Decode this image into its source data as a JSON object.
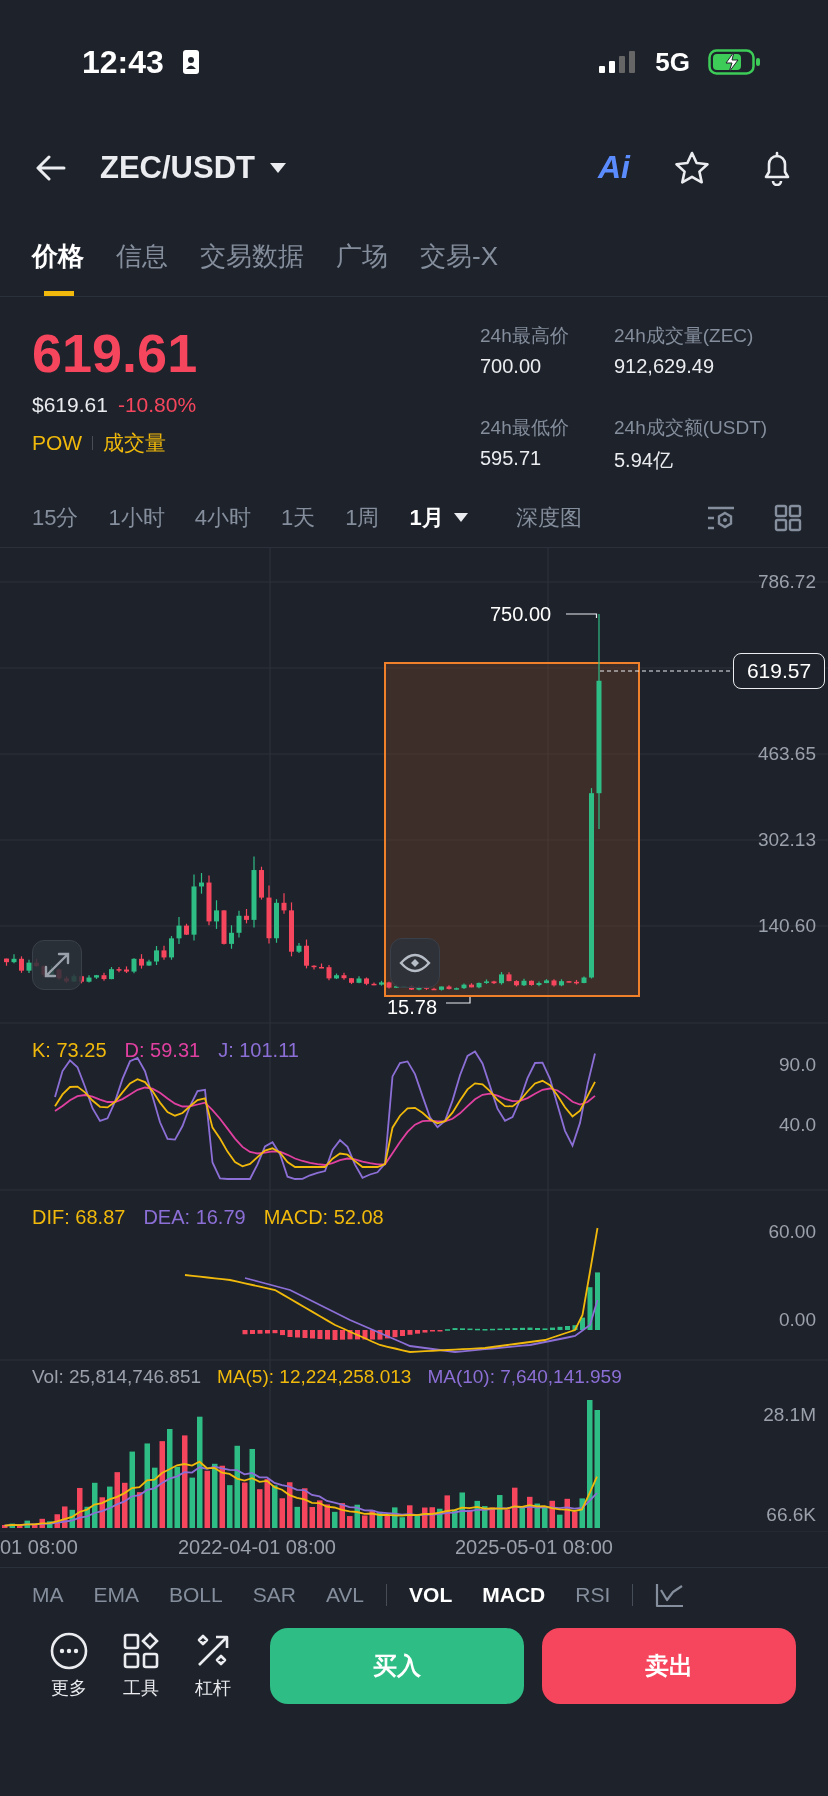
{
  "status_bar": {
    "time": "12:43",
    "network": "5G"
  },
  "header": {
    "pair": "ZEC/USDT",
    "ai_label": "Ai"
  },
  "tabs": [
    {
      "label": "价格",
      "selected": true
    },
    {
      "label": "信息",
      "selected": false
    },
    {
      "label": "交易数据",
      "selected": false
    },
    {
      "label": "广场",
      "selected": false
    },
    {
      "label": "交易-X",
      "selected": false
    }
  ],
  "price": {
    "last": "619.61",
    "usd": "$619.61",
    "change": "-10.80%",
    "tags": [
      "POW",
      "成交量"
    ]
  },
  "stats": [
    {
      "label": "24h最高价",
      "value": "700.00"
    },
    {
      "label": "24h成交量(ZEC)",
      "value": "912,629.49"
    },
    {
      "label": "24h最低价",
      "value": "595.71"
    },
    {
      "label": "24h成交额(USDT)",
      "value": "5.94亿"
    }
  ],
  "intervals": [
    {
      "label": "15分",
      "selected": false
    },
    {
      "label": "1小时",
      "selected": false
    },
    {
      "label": "4小时",
      "selected": false
    },
    {
      "label": "1天",
      "selected": false
    },
    {
      "label": "1周",
      "selected": false
    },
    {
      "label": "1月",
      "selected": true
    },
    {
      "label": "深度图",
      "selected": false
    }
  ],
  "price_chart": {
    "y_labels": [
      "786.72",
      "463.65",
      "302.13",
      "140.60"
    ],
    "high_marker": "750.00",
    "low_marker": "15.78",
    "current_price": "619.57"
  },
  "kdj": {
    "legend": [
      {
        "text": "K: 73.25",
        "color": "#f0b90b"
      },
      {
        "text": "D: 59.31",
        "color": "#e040a0"
      },
      {
        "text": "J: 101.11",
        "color": "#8c6fd6"
      }
    ],
    "y_labels": [
      "90.0",
      "40.0"
    ]
  },
  "macd": {
    "legend": [
      {
        "text": "DIF: 68.87",
        "color": "#f0b90b"
      },
      {
        "text": "DEA: 16.79",
        "color": "#8c6fd6"
      },
      {
        "text": "MACD: 52.08",
        "color": "#f0b90b"
      }
    ],
    "y_labels": [
      "60.00",
      "0.00"
    ]
  },
  "volume": {
    "legend": [
      {
        "text": "Vol: 25,814,746.851",
        "color": "#9ba1ab"
      },
      {
        "text": "MA(5): 12,224,258.013",
        "color": "#f0b90b"
      },
      {
        "text": "MA(10): 7,640,141.959",
        "color": "#8c6fd6"
      }
    ],
    "y_labels": [
      "28.1M",
      "66.6K"
    ]
  },
  "x_labels": [
    "01 08:00",
    "2022-04-01 08:00",
    "2025-05-01 08:00"
  ],
  "main_indicators": [
    {
      "label": "MA",
      "selected": false
    },
    {
      "label": "EMA",
      "selected": false
    },
    {
      "label": "BOLL",
      "selected": false
    },
    {
      "label": "SAR",
      "selected": false
    },
    {
      "label": "AVL",
      "selected": false
    }
  ],
  "sub_indicators": [
    {
      "label": "VOL",
      "selected": true
    },
    {
      "label": "MACD",
      "selected": true
    },
    {
      "label": "RSI",
      "selected": false
    }
  ],
  "tools": [
    {
      "kind": "more",
      "label": "更多"
    },
    {
      "kind": "tools",
      "label": "工具"
    },
    {
      "kind": "leverage",
      "label": "杠杆"
    }
  ],
  "actions": {
    "buy": "买入",
    "sell": "卖出"
  }
}
